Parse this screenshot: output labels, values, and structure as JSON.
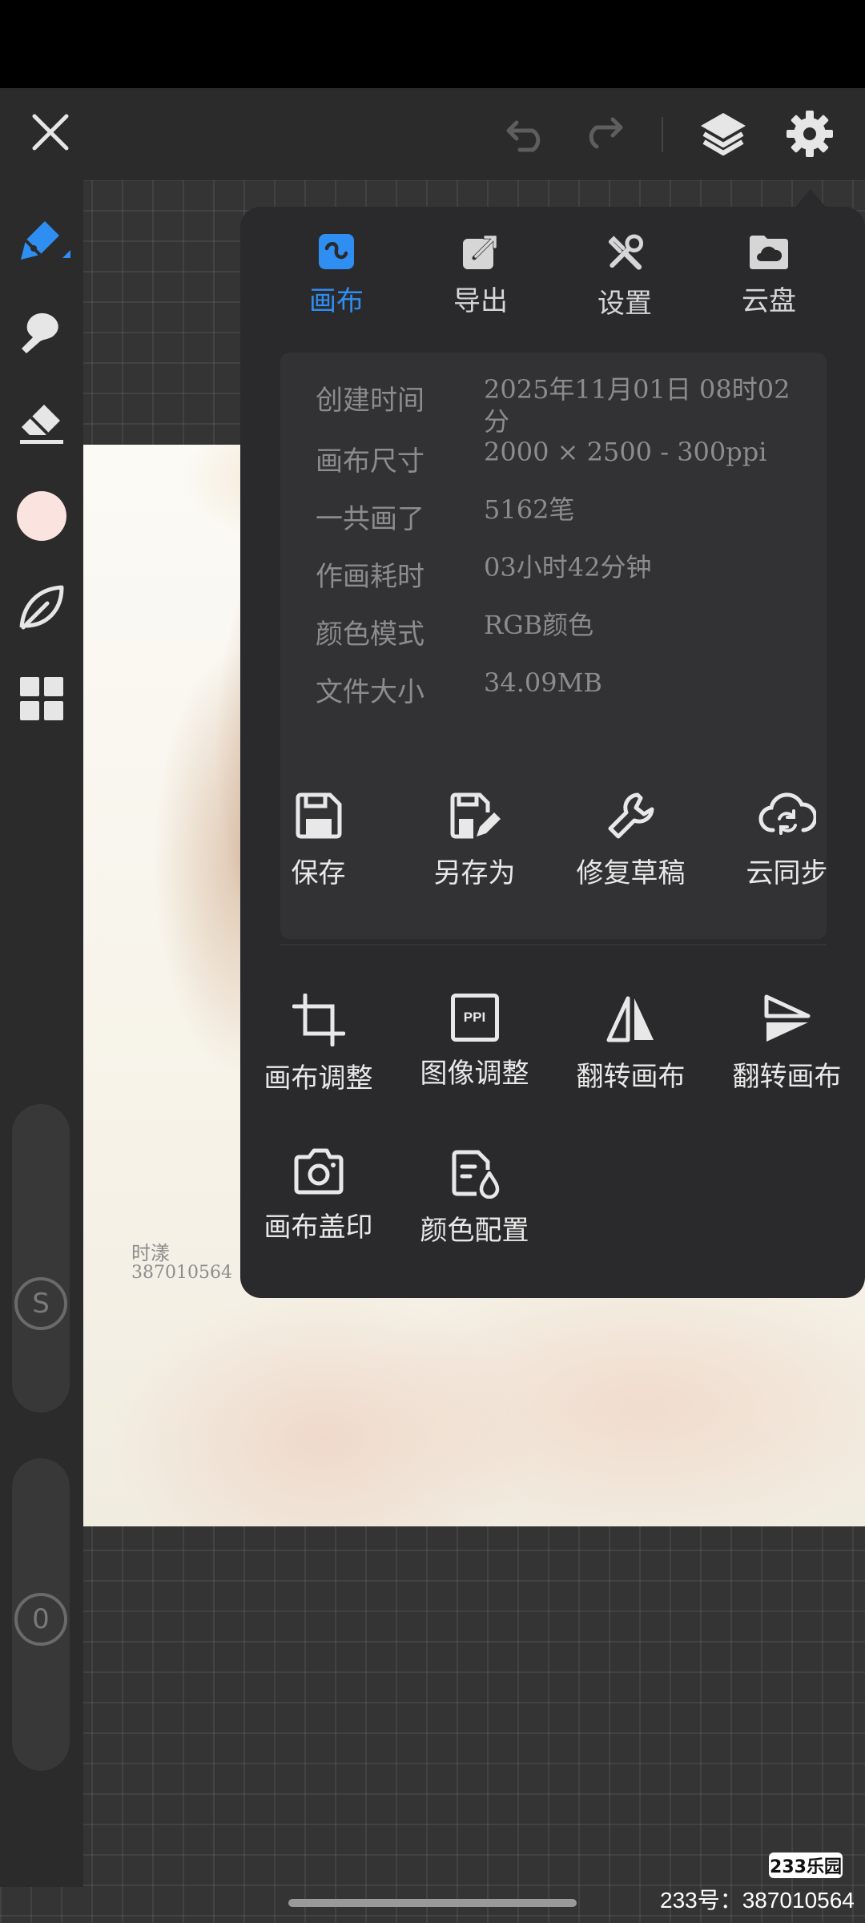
{
  "toolbar": {
    "close_icon": "close-icon",
    "undo_icon": "undo-icon",
    "redo_icon": "redo-icon",
    "layers_icon": "layers-icon",
    "settings_icon": "gear-icon"
  },
  "tools": [
    {
      "name": "pen",
      "icon": "pen-icon",
      "active": true
    },
    {
      "name": "smudge",
      "icon": "smudge-icon"
    },
    {
      "name": "eraser",
      "icon": "eraser-icon"
    },
    {
      "name": "color",
      "icon": "color-swatch",
      "color": "#fbe3df"
    },
    {
      "name": "lasso",
      "icon": "leaf-icon"
    },
    {
      "name": "more",
      "icon": "grid-icon"
    }
  ],
  "sliders": {
    "size_label": "S",
    "opacity_label": "0"
  },
  "canvas": {
    "signature_name": "时漾",
    "signature_id": "387010564"
  },
  "panel": {
    "tabs": [
      {
        "label": "画布",
        "icon": "canvas-icon",
        "active": true
      },
      {
        "label": "导出",
        "icon": "export-icon"
      },
      {
        "label": "设置",
        "icon": "tools-icon"
      },
      {
        "label": "云盘",
        "icon": "cloud-drive-icon"
      }
    ],
    "info": [
      {
        "label": "创建时间",
        "value": "2025年11月01日 08时02分"
      },
      {
        "label": "画布尺寸",
        "value": "2000 × 2500 - 300ppi"
      },
      {
        "label": "一共画了",
        "value": "5162笔"
      },
      {
        "label": "作画耗时",
        "value": "03小时42分钟"
      },
      {
        "label": "颜色模式",
        "value": "RGB颜色"
      },
      {
        "label": "文件大小",
        "value": "34.09MB"
      }
    ],
    "actions_row1": [
      {
        "label": "保存",
        "icon": "save-icon"
      },
      {
        "label": "另存为",
        "icon": "save-as-icon"
      },
      {
        "label": "修复草稿",
        "icon": "wrench-icon"
      },
      {
        "label": "云同步",
        "icon": "cloud-sync-icon"
      }
    ],
    "actions_row2": [
      {
        "label": "画布调整",
        "icon": "crop-icon"
      },
      {
        "label": "图像调整",
        "icon": "ppi-icon",
        "badge": "PPI"
      },
      {
        "label": "翻转画布",
        "icon": "flip-horizontal-icon"
      },
      {
        "label": "翻转画布",
        "icon": "flip-vertical-icon"
      }
    ],
    "actions_row3": [
      {
        "label": "画布盖印",
        "icon": "camera-icon"
      },
      {
        "label": "颜色配置",
        "icon": "color-profile-icon"
      }
    ]
  },
  "watermark": {
    "logo": "233乐园",
    "id_text": "233号：387010564"
  },
  "colors": {
    "accent": "#2f8ef2",
    "panel": "#2a2a2c",
    "toolbar": "#2b2b2b"
  }
}
